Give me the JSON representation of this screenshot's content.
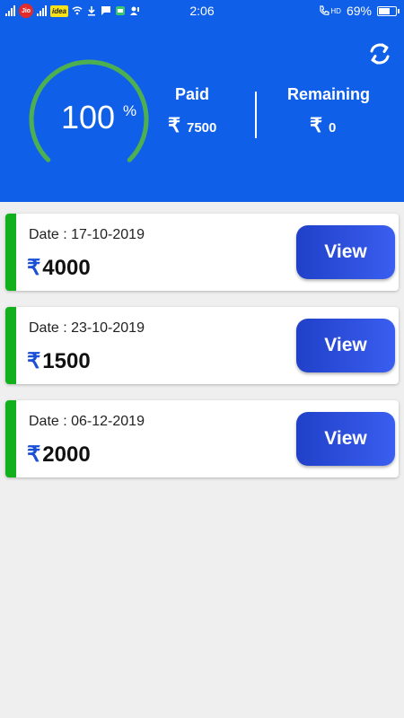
{
  "status_bar": {
    "time": "2:06",
    "carrier1": "Jio",
    "carrier2": "idea",
    "hd_label": "HD",
    "battery": "69%",
    "battery_level": 0.69
  },
  "summary": {
    "percent_value": "100",
    "percent_unit": "%",
    "progress": 1.0,
    "paid_label": "Paid",
    "currency_symbol": "₹",
    "paid_amount": "7500",
    "remaining_label": "Remaining",
    "remaining_amount": "0"
  },
  "payments": [
    {
      "date": "Date : 17-10-2019",
      "currency": "₹",
      "amount": "4000",
      "button": "View"
    },
    {
      "date": "Date : 23-10-2019",
      "currency": "₹",
      "amount": "1500",
      "button": "View"
    },
    {
      "date": "Date : 06-12-2019",
      "currency": "₹",
      "amount": "2000",
      "button": "View"
    }
  ],
  "colors": {
    "header_bg": "#0f5fe8",
    "gauge_green": "#4caf50",
    "card_accent": "#12b01d",
    "button_blue": "#2d4fdc",
    "page_bg": "#efefef"
  },
  "icons": {
    "refresh": "refresh-icon",
    "rupee": "rupee-icon"
  }
}
